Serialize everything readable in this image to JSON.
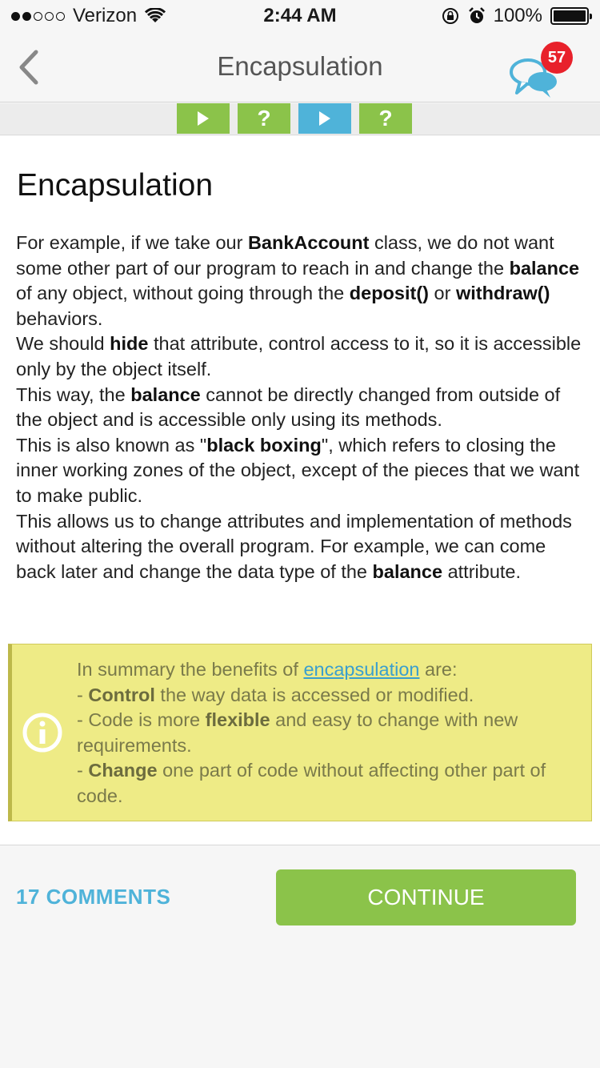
{
  "status_bar": {
    "carrier": "Verizon",
    "signal_filled": 2,
    "signal_total": 5,
    "time": "2:44 AM",
    "battery": "100%",
    "battery_level": 1.0
  },
  "nav": {
    "title": "Encapsulation",
    "badge_count": "57",
    "icons": [
      "chevron-left-icon",
      "chat-bubbles-icon"
    ]
  },
  "steps": [
    {
      "type": "play",
      "color": "#8bc34a",
      "icon": "play-icon"
    },
    {
      "type": "quiz",
      "label": "?",
      "color": "#8bc34a"
    },
    {
      "type": "play",
      "color": "#4fb3d9",
      "icon": "play-icon"
    },
    {
      "type": "quiz",
      "label": "?",
      "color": "#8bc34a"
    }
  ],
  "lesson": {
    "title": "Encapsulation",
    "p1": {
      "a": "For example, if we take our ",
      "b1": "BankAccount",
      "c": " class, we do not want some other part of our program to reach in and change the ",
      "b2": "balance",
      "d": " of any object, without going through the ",
      "b3": "deposit()",
      "e": " or ",
      "b4": "withdraw()",
      "f": " behaviors."
    },
    "p2": {
      "a": "We should ",
      "b1": "hide",
      "c": " that attribute, control access to it, so it is accessible only by the object itself."
    },
    "p3": {
      "a": "This way, the ",
      "b1": "balance",
      "c": " cannot be directly changed from outside of the object and is accessible only using its methods."
    },
    "p4": {
      "a": "This is also known as \"",
      "b1": "black boxing",
      "c": "\", which refers to closing the inner working zones of the object, except of the pieces that we want to make public."
    },
    "p5": {
      "a": "This allows us to change attributes and implementation of methods without altering the overall program. For example, we can come back later and change the data type of the ",
      "b1": "balance",
      "c": " attribute."
    }
  },
  "summary": {
    "intro": "In summary the benefits of ",
    "link": "encapsulation",
    "intro_end": " are:",
    "l1a": "- ",
    "l1b": "Control",
    "l1c": " the way data is accessed or modified.",
    "l2a": "- Code is more ",
    "l2b": "flexible",
    "l2c": " and easy to change with new requirements.",
    "l3a": "- ",
    "l3b": "Change",
    "l3c": " one part of code without affecting other part of code.",
    "icon": "info-icon",
    "bg_color": "#eeeb86"
  },
  "footer": {
    "comments": "17 COMMENTS",
    "continue": "CONTINUE",
    "accent": "#4fb3d9",
    "button_color": "#8bc34a"
  }
}
